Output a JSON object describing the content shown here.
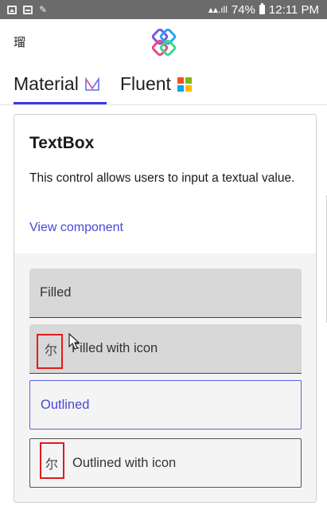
{
  "status_bar": {
    "battery": "74%",
    "time": "12:11 PM"
  },
  "header": {
    "menu_glyph": "瑠",
    "logo_icon": "uno-platform-logo"
  },
  "tabs": [
    {
      "label": "Material",
      "icon": "material-icon",
      "selected": true
    },
    {
      "label": "Fluent",
      "icon": "fluent-windows-icon",
      "selected": false
    }
  ],
  "card": {
    "title": "TextBox",
    "description": "This control allows users to input a textual value.",
    "link": "View component"
  },
  "fields": {
    "filled": "Filled",
    "filled_icon": "Filled with icon",
    "outlined": "Outlined",
    "outlined_icon": "Outlined with icon",
    "icon_glyph": "尔"
  },
  "colors": {
    "accent": "#4848d8",
    "status_bar": "#6b6b6b",
    "highlight": "#e01c1c"
  }
}
